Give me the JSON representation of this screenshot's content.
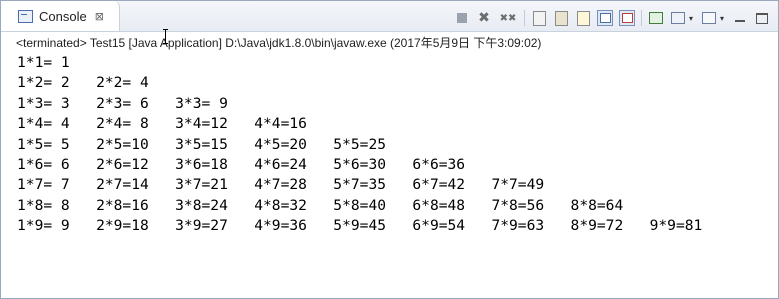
{
  "tab": {
    "title": "Console",
    "icon": "console-icon",
    "close_icon": "close-icon",
    "close_glyph": "⊠"
  },
  "toolbar": {
    "icons": [
      "terminate-icon",
      "remove-launch-icon",
      "remove-all-terminated-icon",
      "clear-console-icon",
      "scroll-lock-icon",
      "word-wrap-icon",
      "pin-console-icon",
      "show-console-on-output-icon",
      "open-console-icon",
      "display-selected-console-icon",
      "dropdown-caret-icon",
      "new-console-icon",
      "dropdown-caret-icon",
      "minimize-icon",
      "maximize-icon"
    ],
    "remove_glyph": "✖",
    "remove_all_glyph": "✖✖",
    "caret_glyph": "▾"
  },
  "status": "<terminated> Test15 [Java Application] D:\\Java\\jdk1.8.0\\bin\\javaw.exe (2017年5月9日 下午3:09:02)",
  "output": {
    "lines": [
      "1*1= 1",
      "1*2= 2   2*2= 4",
      "1*3= 3   2*3= 6   3*3= 9",
      "1*4= 4   2*4= 8   3*4=12   4*4=16",
      "1*5= 5   2*5=10   3*5=15   4*5=20   5*5=25",
      "1*6= 6   2*6=12   3*6=18   4*6=24   5*6=30   6*6=36",
      "1*7= 7   2*7=14   3*7=21   4*7=28   5*7=35   6*7=42   7*7=49",
      "1*8= 8   2*8=16   3*8=24   4*8=32   5*8=40   6*8=48   7*8=56   8*8=64",
      "1*9= 9   2*9=18   3*9=27   4*9=36   5*9=45   6*9=54   7*9=63   8*9=72   9*9=81"
    ]
  },
  "colors": {
    "border": "#99a8bd",
    "tab_bg": "#ffffff",
    "tabbar_bg": "#e8ecf3",
    "text": "#000000"
  }
}
